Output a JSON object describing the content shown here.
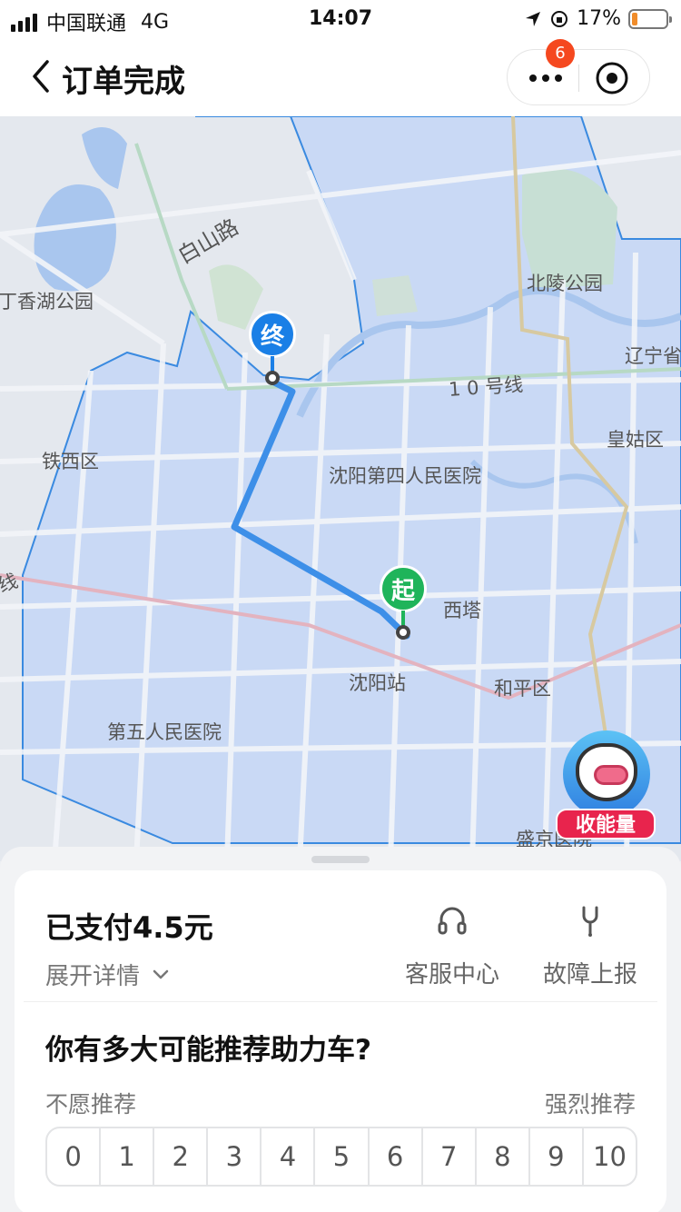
{
  "status_bar": {
    "carrier": "中国联通",
    "network": "4G",
    "time": "14:07",
    "battery": "17%",
    "battery_level": 0.17
  },
  "nav": {
    "title": "订单完成",
    "badge_count": "6",
    "icons": [
      "back-icon",
      "more-icon",
      "target-icon"
    ]
  },
  "map": {
    "labels": {
      "baishan_road": "白山路",
      "dingxiang_park": "丁香湖公园",
      "beiling_park": "北陵公园",
      "liaoning": "辽宁省",
      "line10": "1 0 号线",
      "huanggu": "皇姑区",
      "tiexi": "铁西区",
      "hospital4": "沈阳第四人民医院",
      "xita": "西塔",
      "line_left": "线",
      "shenyang_station": "沈阳站",
      "heping": "和平区",
      "hospital5": "第五人民医院",
      "shengjing": "盛京医院"
    },
    "end_marker": "终",
    "start_marker": "起",
    "energy_label": "收能量",
    "colors": {
      "route": "#3d8fe8",
      "start": "#1fb45a",
      "end": "#1a7fe6"
    }
  },
  "order": {
    "paid_text": "已支付4.5元",
    "details_label": "展开详情",
    "service_label": "客服中心",
    "report_label": "故障上报"
  },
  "survey": {
    "question": "你有多大可能推荐助力车?",
    "low_label": "不愿推荐",
    "high_label": "强烈推荐",
    "scale": [
      "0",
      "1",
      "2",
      "3",
      "4",
      "5",
      "6",
      "7",
      "8",
      "9",
      "10"
    ]
  }
}
